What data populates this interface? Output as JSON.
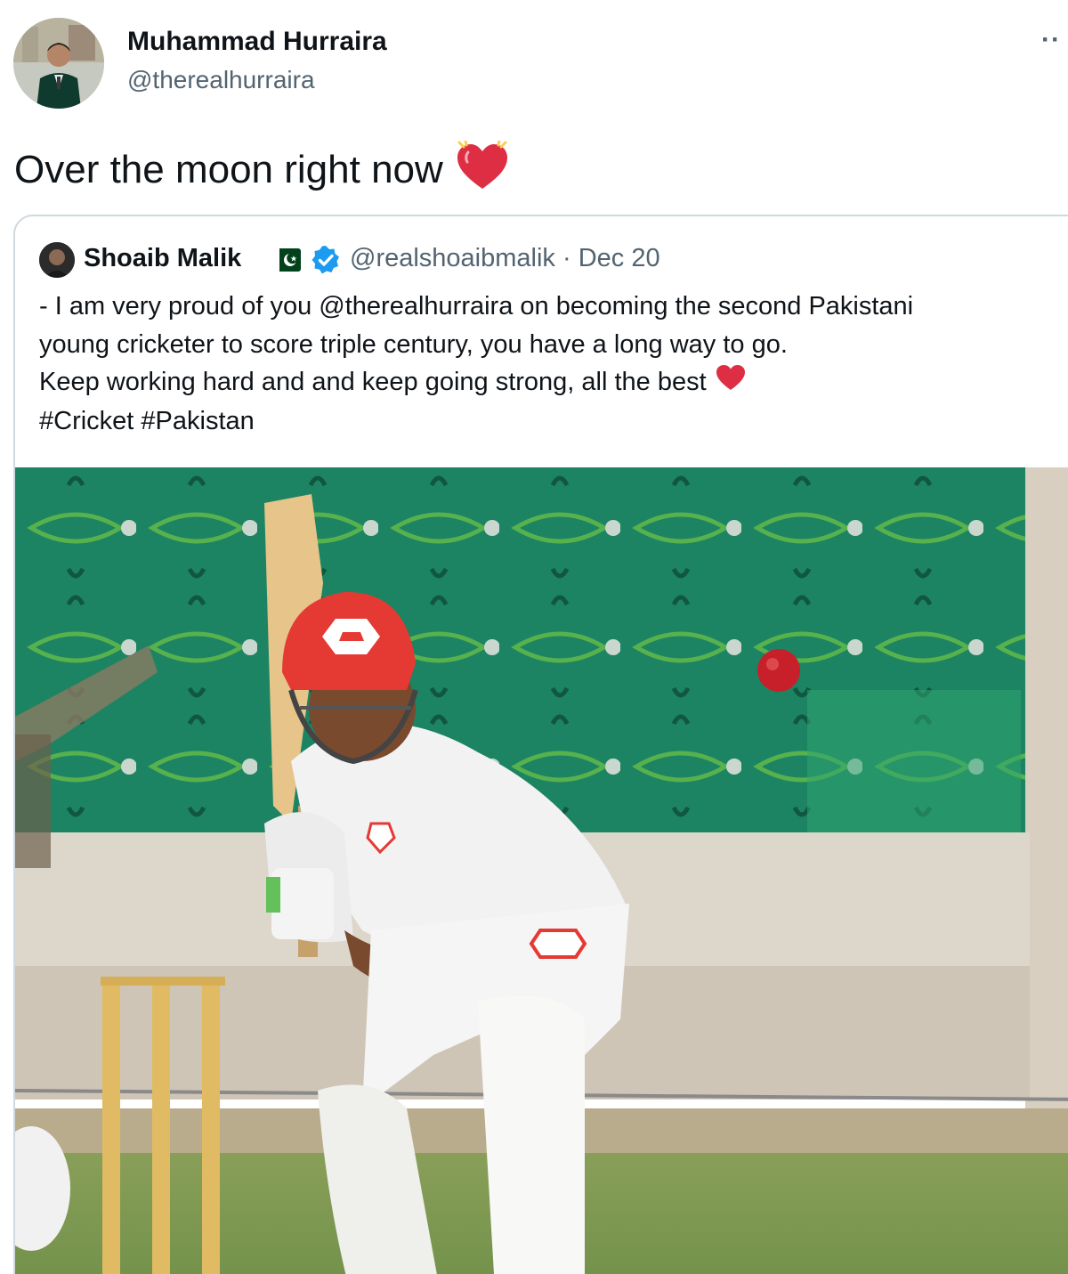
{
  "tweet": {
    "author_name": "Muhammad Hurraira",
    "author_handle": "@therealhurraira",
    "more_label": "··",
    "text": "Over the moon right now",
    "emoji_icon": "heart-with-shine-icon"
  },
  "quoted_tweet": {
    "author_name": "Shoaib Malik",
    "flag_icon": "pakistan-flag-icon",
    "verified_icon": "verified-badge-icon",
    "handle": "@realshoaibmalik",
    "separator": "·",
    "date": "Dec 20",
    "lines": [
      "- I am very proud of you @therealhurraira on becoming the second Pakistani",
      "young cricketer to score triple century, you have a long way to go.",
      "Keep working hard and and keep going strong, all the best",
      "#Cricket #Pakistan"
    ],
    "heart_icon": "red-heart-icon"
  },
  "colors": {
    "primary_text": "#0f1419",
    "secondary_text": "#536471",
    "border": "#cfd9de",
    "verified_blue": "#1d9bf0",
    "heart_red": "#dd2e44",
    "flag_green": "#01411c"
  }
}
